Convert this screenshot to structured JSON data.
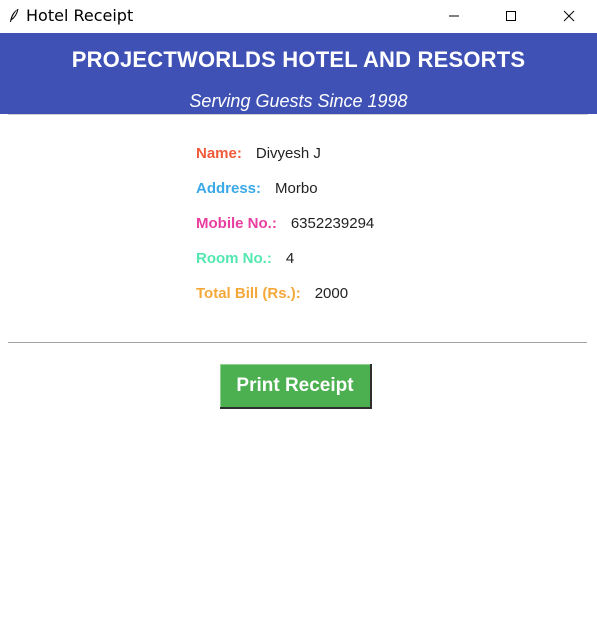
{
  "window": {
    "title": "Hotel Receipt",
    "icon": "feather-icon",
    "controls": [
      "minimize-icon",
      "maximize-icon",
      "close-icon"
    ]
  },
  "header": {
    "hotel_name": "PROJECTWORLDS HOTEL AND RESORTS",
    "tagline": "Serving Guests Since 1998",
    "background_color": "#3f51b5"
  },
  "receipt": {
    "name_label": "Name:",
    "name_value": "Divyesh J",
    "address_label": "Address:",
    "address_value": "Morbo",
    "mobile_label": "Mobile No.:",
    "mobile_value": "6352239294",
    "room_label": "Room No.:",
    "room_value": "4",
    "bill_label": "Total Bill (Rs.):",
    "bill_value": "2000",
    "label_colors": {
      "name": "#f05a3a",
      "address": "#3ba8e8",
      "mobile": "#e93ea0",
      "room": "#52e8b0",
      "bill": "#f5a83a"
    }
  },
  "actions": {
    "print_label": "Print Receipt",
    "print_color": "#4caf50"
  }
}
